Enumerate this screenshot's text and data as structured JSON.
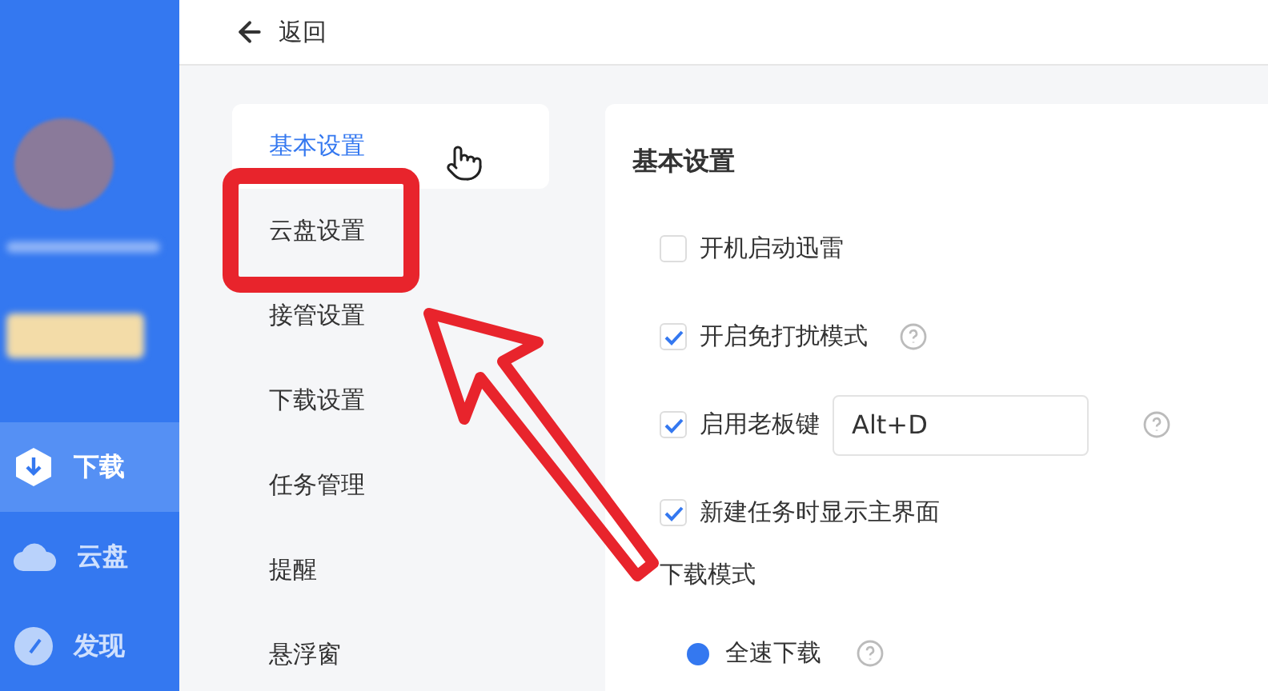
{
  "header": {
    "back_label": "返回"
  },
  "sidebar": {
    "nav_items": [
      {
        "label": "下载",
        "selected": true
      },
      {
        "label": "云盘",
        "selected": false
      },
      {
        "label": "发现",
        "selected": false
      }
    ]
  },
  "settings_menu": [
    {
      "label": "基本设置",
      "selected": true
    },
    {
      "label": "云盘设置",
      "selected": false
    },
    {
      "label": "接管设置",
      "selected": false
    },
    {
      "label": "下载设置",
      "selected": false
    },
    {
      "label": "任务管理",
      "selected": false
    },
    {
      "label": "提醒",
      "selected": false
    },
    {
      "label": "悬浮窗",
      "selected": false
    }
  ],
  "panel": {
    "title": "基本设置",
    "options": [
      {
        "label": "开机启动迅雷",
        "checked": false,
        "help": false
      },
      {
        "label": "开启免打扰模式",
        "checked": true,
        "help": true
      },
      {
        "label": "启用老板键",
        "checked": true,
        "help": true,
        "hotkey": "Alt+D"
      },
      {
        "label": "新建任务时显示主界面",
        "checked": true,
        "help": false
      }
    ],
    "section_label": "下载模式",
    "radios": [
      {
        "label": "全速下载",
        "selected": true,
        "help": true
      }
    ]
  }
}
